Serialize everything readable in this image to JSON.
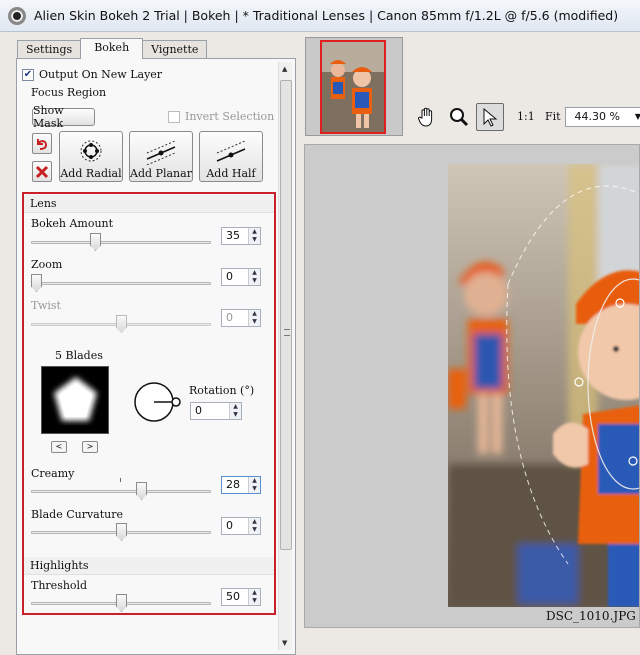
{
  "window": {
    "title": "Alien Skin Bokeh 2 Trial | Bokeh | * Traditional Lenses | Canon  85mm f/1.2L @ f/5.6 (modified)"
  },
  "tabs": [
    {
      "label": "Settings"
    },
    {
      "label": "Bokeh"
    },
    {
      "label": "Vignette"
    }
  ],
  "active_tab": "Bokeh",
  "output_new_layer": {
    "label": "Output On New Layer",
    "checked": true
  },
  "focus_region": {
    "heading": "Focus Region",
    "show_mask": "Show Mask",
    "invert_selection": {
      "label": "Invert Selection",
      "checked": false,
      "enabled": false
    },
    "add_radial": "Add Radial",
    "add_planar": "Add Planar",
    "add_half": "Add Half"
  },
  "lens": {
    "heading": "Lens",
    "bokeh_amount": {
      "label": "Bokeh Amount",
      "value": "35",
      "fraction": 0.35
    },
    "zoom": {
      "label": "Zoom",
      "value": "0",
      "fraction": 0.0
    },
    "twist": {
      "label": "Twist",
      "value": "0",
      "fraction": 0.5,
      "enabled": false
    },
    "blades": {
      "label": "5 Blades",
      "prev": "<",
      "next": ">"
    },
    "rotation": {
      "label": "Rotation (°)",
      "value": "0"
    },
    "creamy": {
      "label": "Creamy",
      "value": "28",
      "fraction": 0.62
    },
    "blade_curvature": {
      "label": "Blade Curvature",
      "value": "0",
      "fraction": 0.5
    }
  },
  "highlights": {
    "heading": "Highlights",
    "threshold": {
      "label": "Threshold",
      "value": "50",
      "fraction": 0.5
    }
  },
  "toolbar": {
    "one_to_one": "1:1",
    "fit": "Fit",
    "zoom_value": "44.30 %"
  },
  "preview": {
    "filename": "DSC_1010.JPG"
  },
  "colors": {
    "highlight_border": "#c8202a",
    "focus_accent": "#e02020"
  },
  "icons": [
    "hand-icon",
    "magnifier-icon",
    "arrow-cursor-icon",
    "undo-icon",
    "delete-icon",
    "radial-icon",
    "planar-icon",
    "half-icon"
  ]
}
